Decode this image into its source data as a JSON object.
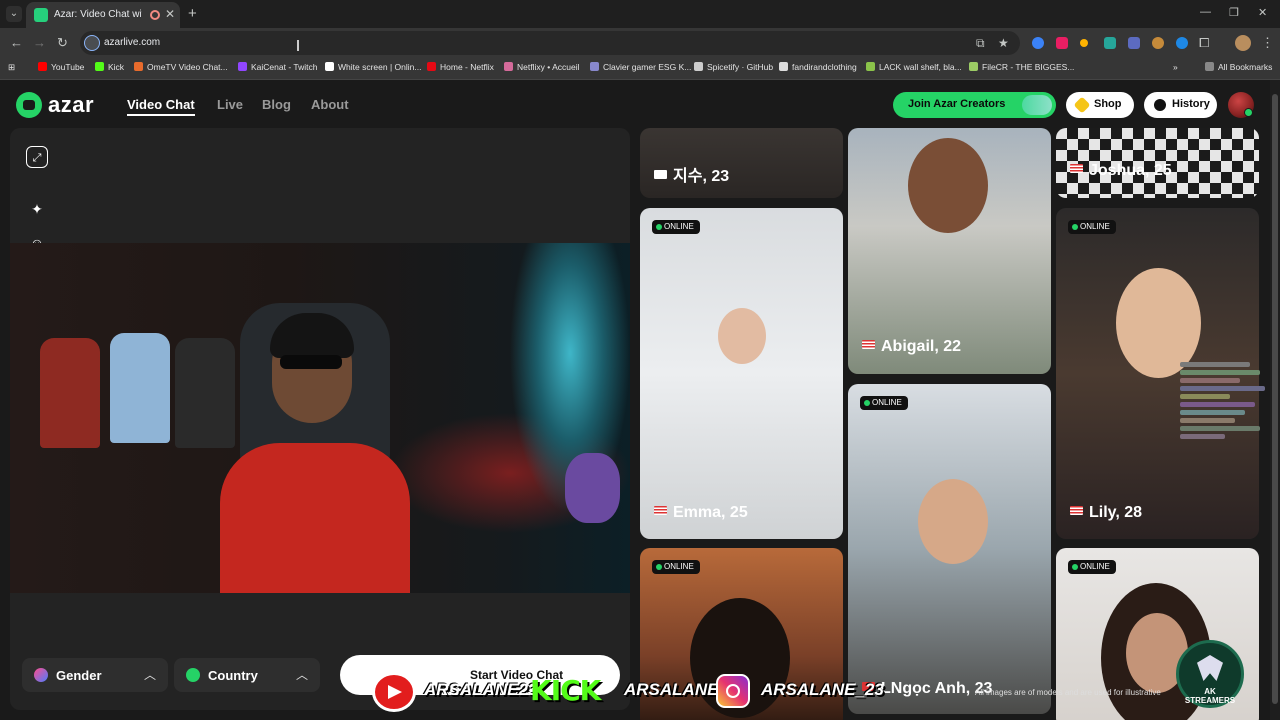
{
  "browser": {
    "tab": {
      "title": "Azar: Video Chat with New"
    },
    "url": "azarlive.com",
    "bookmarks": [
      {
        "label": "YouTube",
        "color": "#ff0000"
      },
      {
        "label": "Kick",
        "color": "#53fc18"
      },
      {
        "label": "OmeTV Video Chat...",
        "color": "#e86b2c"
      },
      {
        "label": "KaiCenat - Twitch",
        "color": "#9146ff"
      },
      {
        "label": "White screen | Onlin...",
        "color": "#ffffff"
      },
      {
        "label": "Home - Netflix",
        "color": "#e50914"
      },
      {
        "label": "Netflixy • Accueil",
        "color": "#d46a9a"
      },
      {
        "label": "Clavier gamer ESG K...",
        "color": "#8888cc"
      },
      {
        "label": "Spicetify · GitHub",
        "color": "#cccccc"
      },
      {
        "label": "fandirandclothing",
        "color": "#dddddd"
      },
      {
        "label": "LACK wall shelf, bla...",
        "color": "#8bc34a"
      },
      {
        "label": "FileCR - THE BIGGES...",
        "color": "#9ccc65"
      }
    ],
    "all_bookmarks": "All Bookmarks"
  },
  "site": {
    "logo": "azar",
    "nav": [
      {
        "label": "Video Chat",
        "active": true
      },
      {
        "label": "Live",
        "active": false
      },
      {
        "label": "Blog",
        "active": false
      },
      {
        "label": "About",
        "active": false
      }
    ],
    "join_creators": "Join Azar Creators",
    "shop": "Shop",
    "history": "History"
  },
  "controls": {
    "gender": "Gender",
    "country": "Country",
    "start": "Start Video Chat"
  },
  "cards": [
    {
      "name": "지수, 23",
      "flag": "kr",
      "online": false
    },
    {
      "name": "Abigail, 22",
      "flag": "us",
      "online": false
    },
    {
      "name": "Joshua, 25",
      "flag": "us",
      "online": false
    },
    {
      "name": "Emma, 25",
      "flag": "us",
      "online": true
    },
    {
      "name": "Lily, 28",
      "flag": "us",
      "online": true
    },
    {
      "name": "",
      "flag": "",
      "online": true
    },
    {
      "name": "LNgọc Anh, 23",
      "flag": "vn",
      "online": true
    },
    {
      "name": "",
      "flag": "",
      "online": true
    }
  ],
  "online_label": "ONLINE",
  "overlay": {
    "youtube_handle": "ARSALANE23",
    "kick_label": "KICK",
    "kick_handle": "ARSALANE1",
    "instagram_handle": "ARSALANE_23",
    "disclaimer": "All images are of models and are used for illustrative",
    "streamer_logo": "AK STREAMERS"
  }
}
